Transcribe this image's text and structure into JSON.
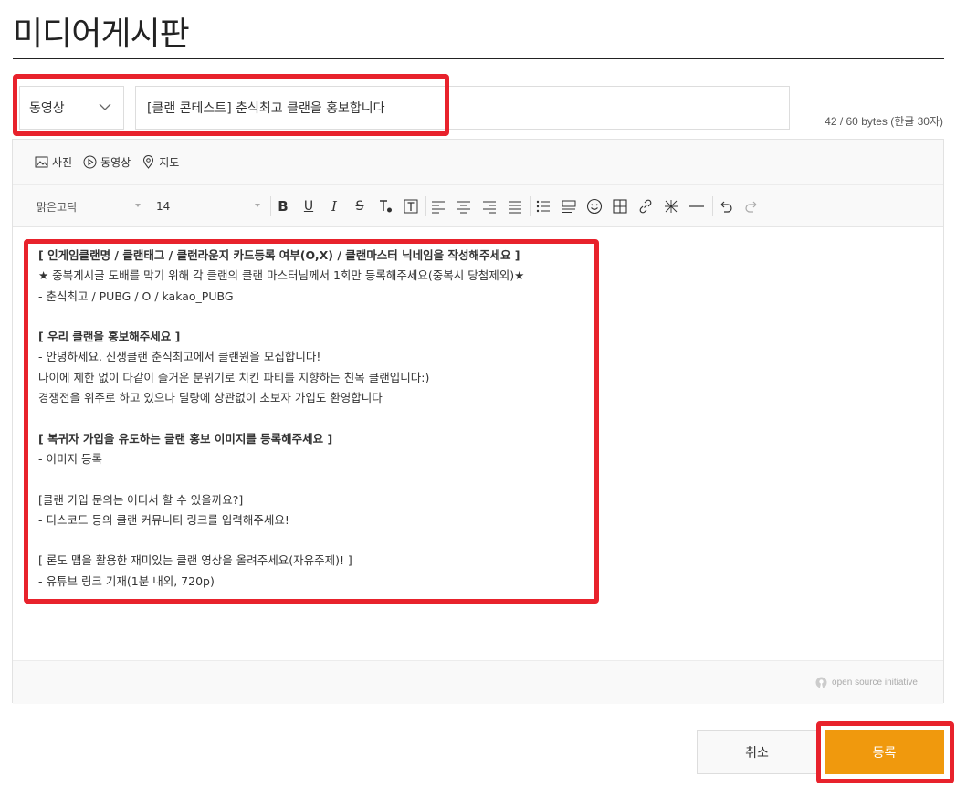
{
  "page": {
    "title": "미디어게시판"
  },
  "form": {
    "category_value": "동영상",
    "title_value": "[클랜 콘테스트] 춘식최고 클랜을 홍보합니다",
    "byte_counter": "42 / 60 bytes (한글 30자)"
  },
  "media_bar": {
    "photo_label": "사진",
    "video_label": "동영상",
    "map_label": "지도"
  },
  "format_bar": {
    "font_value": "맑은고딕",
    "size_value": "14",
    "icons": [
      "bold-icon",
      "underline-icon",
      "italic-icon",
      "strikethrough-icon",
      "text-color-icon",
      "background-color-icon",
      "align-left-icon",
      "align-center-icon",
      "align-right-icon",
      "align-justify-icon",
      "bullet-list-icon",
      "quote-icon",
      "emoji-icon",
      "table-icon",
      "link-icon",
      "clear-format-icon",
      "horizontal-rule-icon",
      "undo-icon",
      "redo-icon"
    ]
  },
  "content": {
    "l1": "[ 인게임클랜명 / 클랜태그 / 클랜라운지 카드등록 여부(O,X) / 클랜마스터 닉네임을 작성해주세요 ]",
    "l2": "★ 중복게시글 도배를 막기 위해 각 클랜의 클랜 마스터님께서 1회만 등록해주세요(중복시 당첨제외)★",
    "l3": "- 춘식최고 / PUBG / O / kakao_PUBG",
    "l5": "[ 우리 클랜을 홍보해주세요 ]",
    "l6": "- 안녕하세요. 신생클랜 춘식최고에서 클랜원을 모집합니다!",
    "l7": "나이에 제한 없이 다같이 즐거운 분위기로 치킨 파티를 지향하는 친목 클랜입니다:)",
    "l8": "경쟁전을 위주로 하고 있으나 딜량에 상관없이 초보자 가입도 환영합니다",
    "l10": "[ 복귀자 가입을 유도하는 클랜 홍보 이미지를 등록해주세요 ]",
    "l11": "-  이미지 등록",
    "l13": "[클랜 가입 문의는 어디서 할 수 있을까요?]",
    "l14": "- 디스코드 등의 클랜 커뮤니티 링크를 입력해주세요!",
    "l16": "[ 론도 맵을 활용한 재미있는 클랜 영상을 올려주세요(자유주제)! ]",
    "l17": "- 유튜브 링크 기재(1분 내외, 720p)"
  },
  "footer": {
    "osi_label": "open source initiative"
  },
  "actions": {
    "cancel_label": "취소",
    "submit_label": "등록"
  },
  "colors": {
    "accent": "#f0990d",
    "highlight": "#e8222c"
  }
}
